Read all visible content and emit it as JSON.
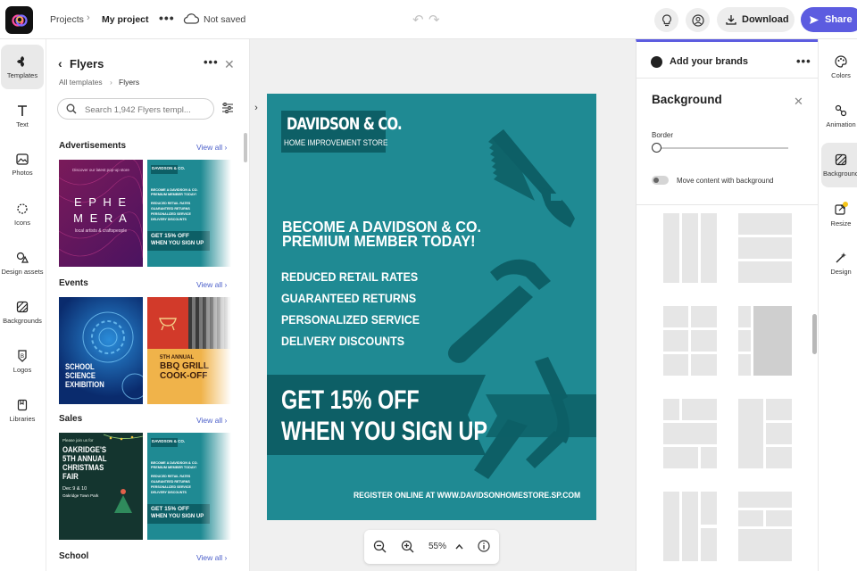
{
  "topbar": {
    "projects": "Projects",
    "project_name": "My project",
    "save_status": "Not saved",
    "download_label": "Download",
    "share_label": "Share"
  },
  "rail": [
    "Templates",
    "Text",
    "Photos",
    "Icons",
    "Design assets",
    "Backgrounds",
    "Logos",
    "Libraries"
  ],
  "panel": {
    "title": "Flyers",
    "crumb_root": "All templates",
    "crumb_current": "Flyers",
    "search_placeholder": "Search 1,942 Flyers templ...",
    "view_all": "View all",
    "sections": [
      "Advertisements",
      "Events",
      "Sales",
      "School"
    ],
    "thumbs": {
      "ephemera": {
        "top": "Discover our latest pop-up store",
        "title1": "E P H E",
        "title2": "M E R A",
        "sub": "local artists & craftspeople"
      },
      "davidson_small": {
        "brand": "DAVIDSON & CO.",
        "head": "BECOME A DAVIDSON & CO. PREMIUM MEMBER TODAY!",
        "list": [
          "REDUCED RETAIL RATES",
          "GUARANTEED RETURNS",
          "PERSONALIZED SERVICE",
          "DELIVERY DISCOUNTS"
        ],
        "offer1": "GET 15% OFF",
        "offer2": "WHEN YOU SIGN UP"
      },
      "science": [
        "SCHOOL",
        "SCIENCE",
        "EXHIBITION"
      ],
      "bbq": {
        "l1": "5TH ANNUAL",
        "l2": "BBQ GRILL",
        "l3": "COOK-OFF"
      },
      "christmas": {
        "top": "Please join us for",
        "lines": [
          "OAKRIDGE'S",
          "5TH ANNUAL",
          "CHRISTMAS",
          "FAIR"
        ],
        "date": "Dec 9 & 10",
        "place": "Oakridge Town Park"
      }
    }
  },
  "flyer": {
    "brand_name": "DAVIDSON & CO.",
    "brand_sub": "HOME IMPROVEMENT STORE",
    "headline1": "BECOME A DAVIDSON & CO.",
    "headline2": "PREMIUM MEMBER TODAY!",
    "benefits": [
      "REDUCED RETAIL RATES",
      "GUARANTEED RETURNS",
      "PERSONALIZED SERVICE",
      "DELIVERY DISCOUNTS"
    ],
    "offer1": "GET 15% OFF",
    "offer2": "WHEN YOU SIGN UP",
    "footer": "REGISTER ONLINE AT    WWW.DAVIDSONHOMESTORE.SP.COM"
  },
  "zoom": {
    "level": "55%"
  },
  "right_panel": {
    "brands_label": "Add your brands",
    "section_title": "Background",
    "border_label": "Border",
    "border_value": 0,
    "move_label": "Move content with background",
    "move_enabled": false
  },
  "right_rail": [
    "Colors",
    "Animation",
    "Background",
    "Resize",
    "Design"
  ],
  "colors": {
    "accent": "#5c5ce0",
    "flyer_bg": "#1f8a93",
    "flyer_dark": "#0d5f66"
  }
}
